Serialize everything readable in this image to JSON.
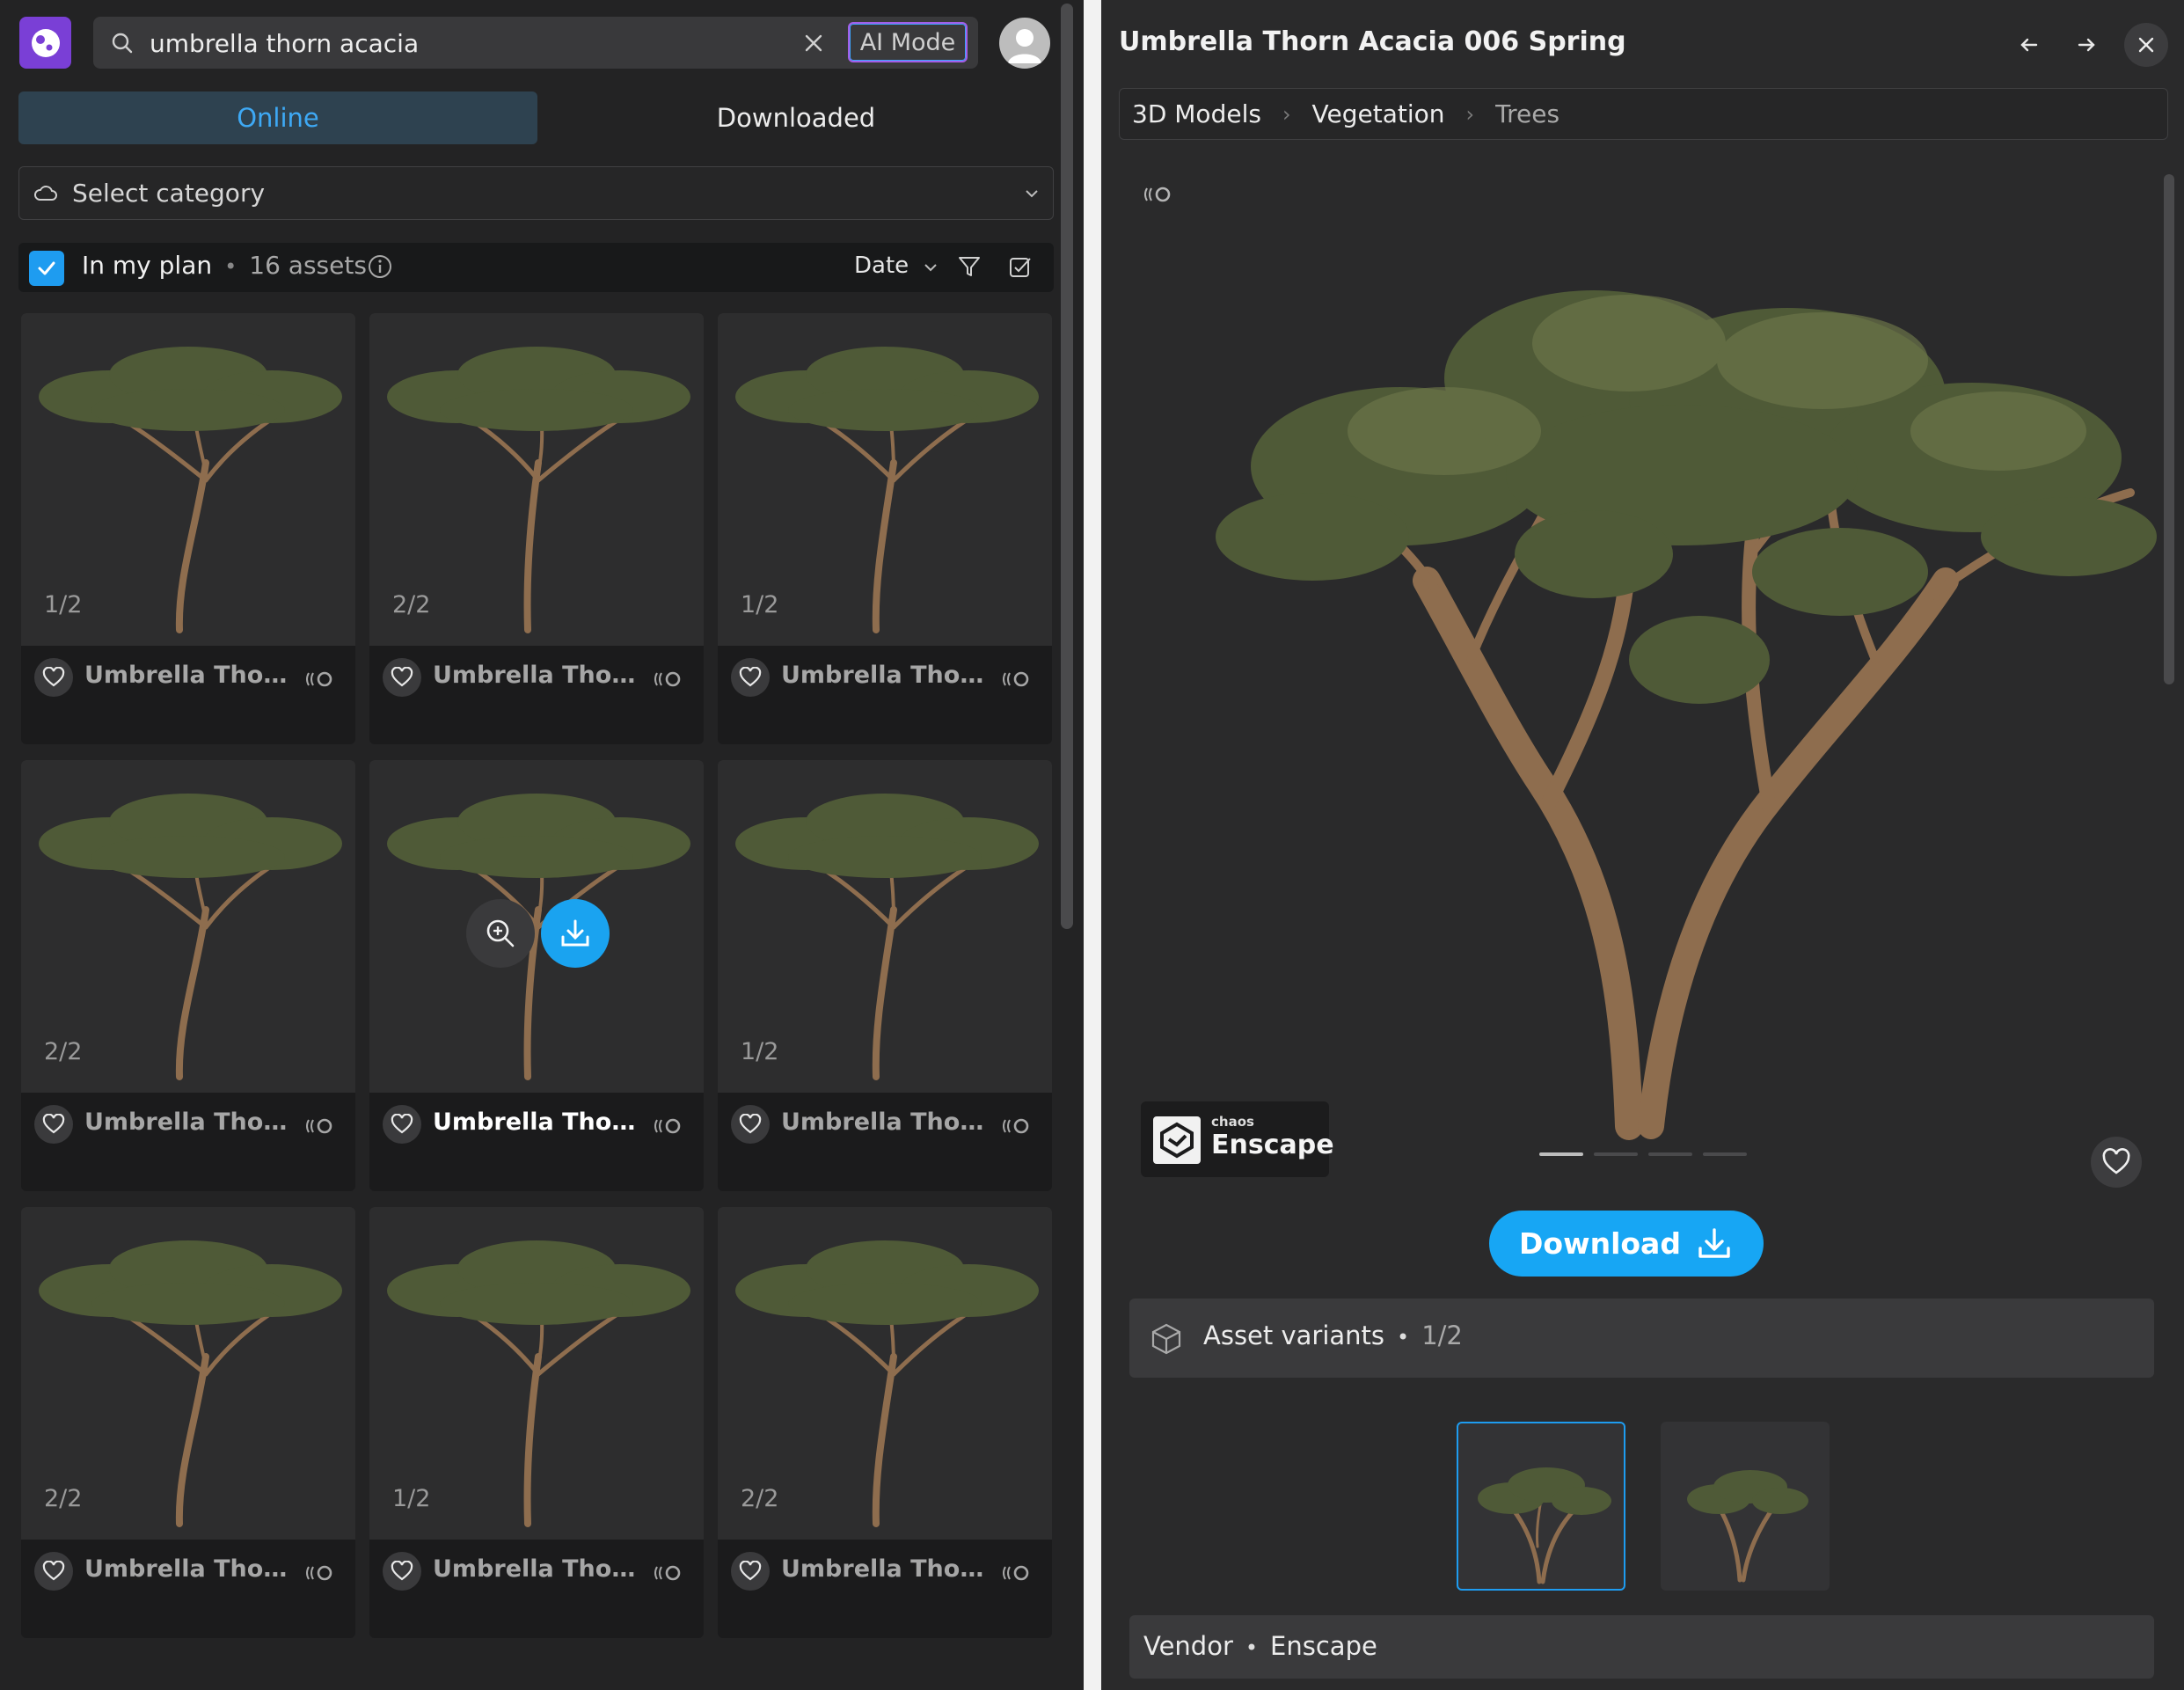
{
  "search": {
    "query": "umbrella thorn acacia",
    "ai_mode_label": "AI Mode"
  },
  "tabs": {
    "online": "Online",
    "downloaded": "Downloaded"
  },
  "category_select": {
    "placeholder": "Select category"
  },
  "plan_bar": {
    "label": "In my plan",
    "count": "16 assets",
    "sort_label": "Date"
  },
  "assets": [
    {
      "name": "Umbrella Thorn...",
      "variant": "1/2"
    },
    {
      "name": "Umbrella Thorn...",
      "variant": "2/2"
    },
    {
      "name": "Umbrella Thorn...",
      "variant": "1/2"
    },
    {
      "name": "Umbrella Thorn...",
      "variant": "2/2"
    },
    {
      "name": "Umbrella Thorn...",
      "variant": ""
    },
    {
      "name": "Umbrella Thorn...",
      "variant": "1/2"
    },
    {
      "name": "Umbrella Thorn...",
      "variant": "2/2"
    },
    {
      "name": "Umbrella Thorn...",
      "variant": "1/2"
    },
    {
      "name": "Umbrella Thorn...",
      "variant": "2/2"
    }
  ],
  "detail": {
    "title": "Umbrella Thorn Acacia 006 Spring",
    "breadcrumb": [
      "3D Models",
      "Vegetation",
      "Trees"
    ],
    "badge_small": "chaos",
    "badge_big": "Enscape",
    "download_label": "Download",
    "variants_label": "Asset variants",
    "variants_count": "1/2",
    "vendor_label": "Vendor",
    "vendor_value": "Enscape"
  },
  "colors": {
    "accent": "#1aa3f0",
    "ai_mode_border": "#a45ee8",
    "logo": "#7a3fd6"
  }
}
